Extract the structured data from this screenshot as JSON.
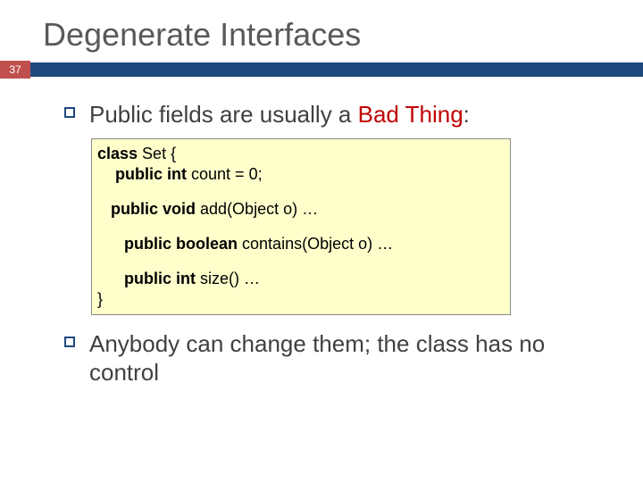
{
  "slide": {
    "title": "Degenerate Interfaces",
    "page_number": "37",
    "bullets": [
      {
        "prefix": "Public fields are usually a ",
        "emph": "Bad Thing",
        "suffix": ":"
      },
      {
        "text": "Anybody can change them; the class has no control"
      }
    ],
    "code": {
      "l1_kw": "class",
      "l1_rest": " Set {",
      "l2_kw": "public int",
      "l2_rest": " count = 0;",
      "l3_kw": "public void",
      "l3_rest": " add(Object o) …",
      "l4_kw": "public boolean",
      "l4_rest": " contains(Object o) …",
      "l5_kw": "public int",
      "l5_rest": " size() …",
      "l6": "}"
    }
  }
}
